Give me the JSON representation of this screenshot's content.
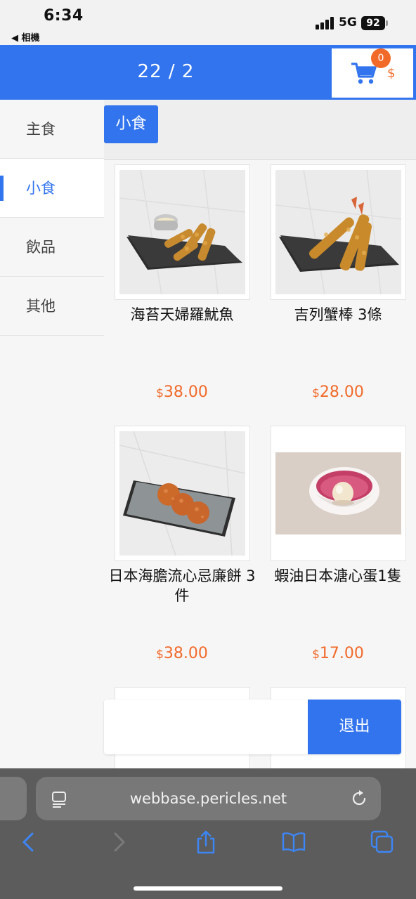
{
  "status_bar": {
    "time": "6:34",
    "back_app": "◀ 相機",
    "network": "5G",
    "battery": "92"
  },
  "header": {
    "title": "22 / 2",
    "cart_count": "0",
    "cart_currency": "$"
  },
  "categories": [
    {
      "label": "主食",
      "active": false
    },
    {
      "label": "小食",
      "active": true
    },
    {
      "label": "飲品",
      "active": false
    },
    {
      "label": "其他",
      "active": false
    }
  ],
  "section": {
    "tab_label": "小食"
  },
  "products": [
    {
      "name": "海苔天婦羅魷魚",
      "currency": "$",
      "price": "38.00",
      "image": "tempura-squid-photo"
    },
    {
      "name": "吉列蟹棒 3條",
      "currency": "$",
      "price": "28.00",
      "image": "fried-crab-stick-photo"
    },
    {
      "name": "日本海膽流心忌廉餅 3件",
      "currency": "$",
      "price": "38.00",
      "image": "sea-urchin-croquette-photo"
    },
    {
      "name": "蝦油日本溏心蛋1隻",
      "currency": "$",
      "price": "17.00",
      "image": "soft-boiled-egg-photo"
    }
  ],
  "action_bar": {
    "exit_label": "退出"
  },
  "safari": {
    "url": "webbase.pericles.net"
  },
  "colors": {
    "accent": "#3274ee",
    "price": "#f26a2a"
  }
}
